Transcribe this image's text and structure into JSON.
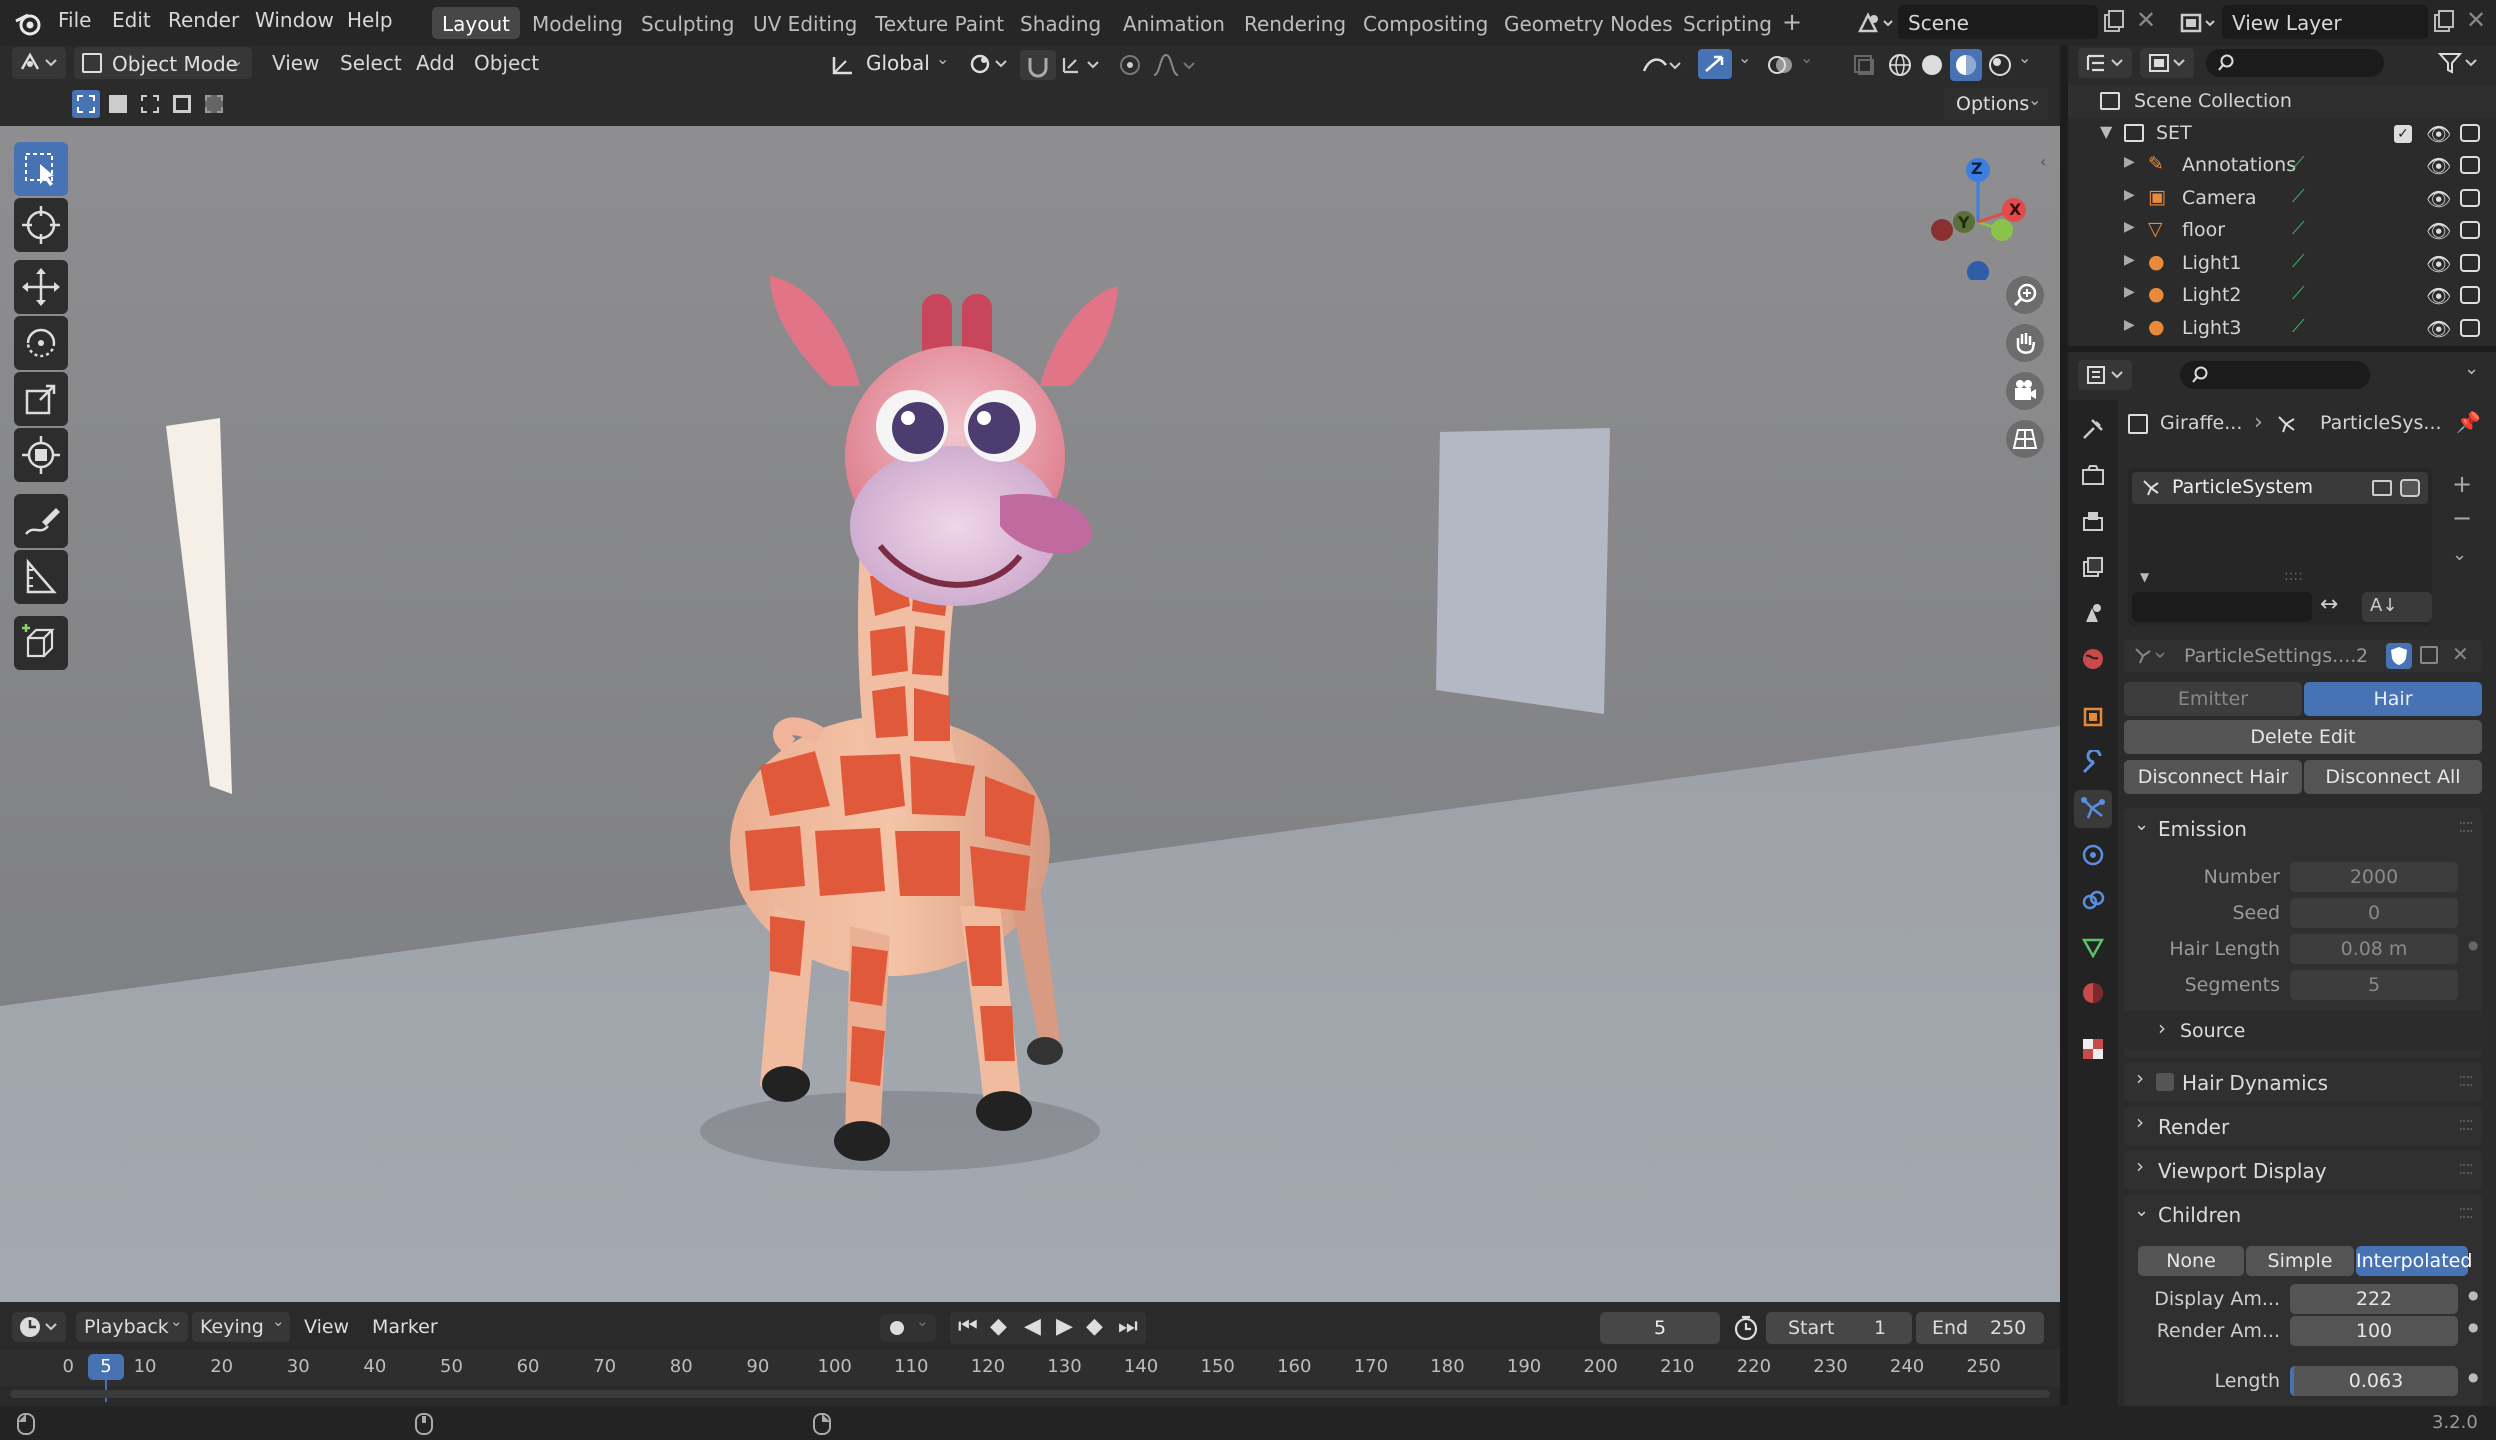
{
  "app": {
    "version": "3.2.0"
  },
  "menu": [
    "File",
    "Edit",
    "Render",
    "Window",
    "Help"
  ],
  "workspaces": [
    "Layout",
    "Modeling",
    "Sculpting",
    "UV Editing",
    "Texture Paint",
    "Shading",
    "Animation",
    "Rendering",
    "Compositing",
    "Geometry Nodes",
    "Scripting"
  ],
  "active_workspace": "Layout",
  "scene": {
    "label": "Scene",
    "view_layer": "View Layer"
  },
  "viewport_header": {
    "mode": "Object Mode",
    "menus": [
      "View",
      "Select",
      "Add",
      "Object"
    ],
    "transform_orientation": "Global",
    "options_label": "Options"
  },
  "gizmo_axes": {
    "z": "Z",
    "y": "Y",
    "x": "X"
  },
  "timeline": {
    "menus": [
      "Playback",
      "Keying",
      "View",
      "Marker"
    ],
    "current_frame": "5",
    "start_label": "Start",
    "start_value": "1",
    "end_label": "End",
    "end_value": "250",
    "ticks": [
      "0",
      "10",
      "20",
      "30",
      "40",
      "50",
      "60",
      "70",
      "80",
      "90",
      "100",
      "110",
      "120",
      "130",
      "140",
      "150",
      "160",
      "170",
      "180",
      "190",
      "200",
      "210",
      "220",
      "230",
      "240",
      "250"
    ]
  },
  "outliner": {
    "root": "Scene Collection",
    "collection": "SET",
    "items": [
      "Annotations",
      "Camera",
      "floor",
      "Light1",
      "Light2",
      "Light3"
    ]
  },
  "properties": {
    "breadcrumb_object": "Giraffe...",
    "breadcrumb_system": "ParticleSys...",
    "particle_system": "ParticleSystem",
    "settings_name": "ParticleSettings....",
    "settings_users": "2",
    "type_emitter": "Emitter",
    "type_hair": "Hair",
    "delete_edit": "Delete Edit",
    "disconnect_hair": "Disconnect Hair",
    "disconnect_all": "Disconnect All",
    "emission": {
      "title": "Emission",
      "number_label": "Number",
      "number_value": "2000",
      "seed_label": "Seed",
      "seed_value": "0",
      "hair_length_label": "Hair Length",
      "hair_length_value": "0.08 m",
      "segments_label": "Segments",
      "segments_value": "5",
      "source": "Source"
    },
    "hair_dynamics": "Hair Dynamics",
    "render": "Render",
    "viewport_display": "Viewport Display",
    "children": {
      "title": "Children",
      "none": "None",
      "simple": "Simple",
      "interpolated": "Interpolated",
      "display_amount_label": "Display Am...",
      "display_amount_value": "222",
      "render_amount_label": "Render Am...",
      "render_amount_value": "100",
      "length_label": "Length",
      "length_value": "0.063"
    }
  },
  "colors": {
    "accent": "#4772b3",
    "axis_x": "#e34b4b",
    "axis_y": "#8bc34a",
    "axis_z": "#3c7ee0"
  }
}
